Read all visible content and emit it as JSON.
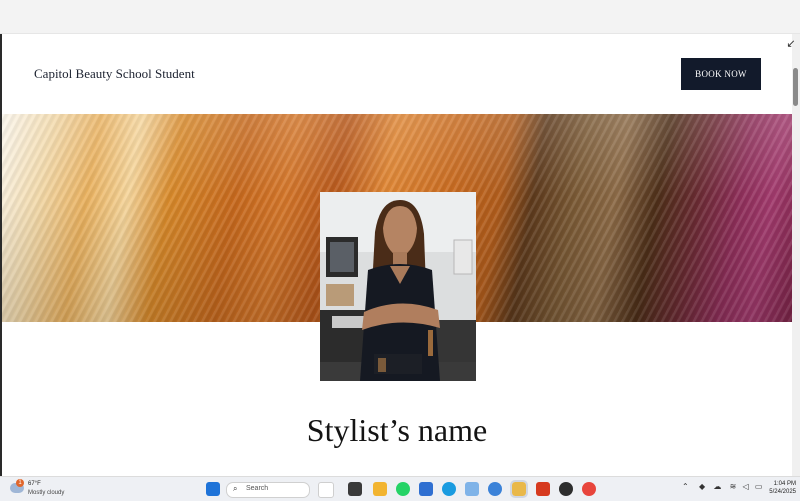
{
  "site": {
    "title": "Capitol Beauty School Student",
    "book_label": "BOOK NOW"
  },
  "profile": {
    "name": "Stylist’s name"
  },
  "taskbar": {
    "weather_badge": "1",
    "temperature": "67°F",
    "weather_desc": "Mostly cloudy",
    "search_label": "Search",
    "time": "1:04 PM",
    "date": "5/24/2025"
  },
  "icons": {
    "collapse": "collapse-arrow-icon",
    "search": "search-icon",
    "start": "windows-start-icon"
  }
}
